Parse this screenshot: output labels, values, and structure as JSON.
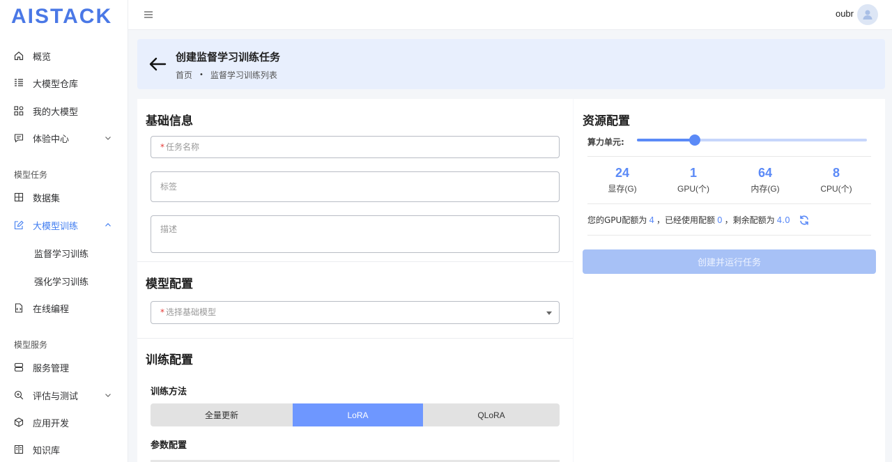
{
  "brand": {
    "logo_text": "AISTACK"
  },
  "header": {
    "username": "oubr"
  },
  "sidebar": {
    "items": [
      {
        "label": "概览"
      },
      {
        "label": "大模型仓库"
      },
      {
        "label": "我的大模型"
      },
      {
        "label": "体验中心"
      }
    ],
    "group_tasks": "模型任务",
    "task_items": [
      {
        "label": "数据集"
      },
      {
        "label": "大模型训练"
      }
    ],
    "sub_items": [
      {
        "label": "监督学习训练"
      },
      {
        "label": "强化学习训练"
      }
    ],
    "online": "在线编程",
    "group_services": "模型服务",
    "service_items": [
      {
        "label": "服务管理"
      },
      {
        "label": "评估与测试"
      },
      {
        "label": "应用开发"
      },
      {
        "label": "知识库"
      }
    ]
  },
  "page": {
    "title": "创建监督学习训练任务",
    "breadcrumb": [
      "首页",
      "监督学习训练列表"
    ],
    "breadcrumb_sep": "•"
  },
  "form": {
    "basic_title": "基础信息",
    "task_name_placeholder": "任务名称",
    "tags_placeholder": "标签",
    "desc_placeholder": "描述",
    "model_title": "模型配置",
    "base_model_placeholder": "选择基础模型",
    "training_title": "训练配置",
    "method_label": "训练方法",
    "methods": [
      "全量更新",
      "LoRA",
      "QLoRA"
    ],
    "selected_method": "LoRA",
    "params_label": "参数配置",
    "required_mark": "*"
  },
  "resources": {
    "title": "资源配置",
    "slider_label": "算力单元:",
    "slider_value_fraction": 0.25,
    "stats": [
      {
        "value": "24",
        "label": "显存(G)"
      },
      {
        "value": "1",
        "label": "GPU(个)"
      },
      {
        "value": "64",
        "label": "内存(G)"
      },
      {
        "value": "8",
        "label": "CPU(个)"
      }
    ],
    "quota_prefix": "您的GPU配额为",
    "quota_total": "4",
    "quota_used_prefix": "，已经使用配额",
    "quota_used": "0",
    "quota_remaining_prefix": "，剩余配额为",
    "quota_remaining": "4.0",
    "submit_label": "创建并运行任务"
  },
  "colors": {
    "accent": "#5b8af7",
    "active_menu": "#3f7cf0",
    "banner_bg": "#e8effd"
  }
}
